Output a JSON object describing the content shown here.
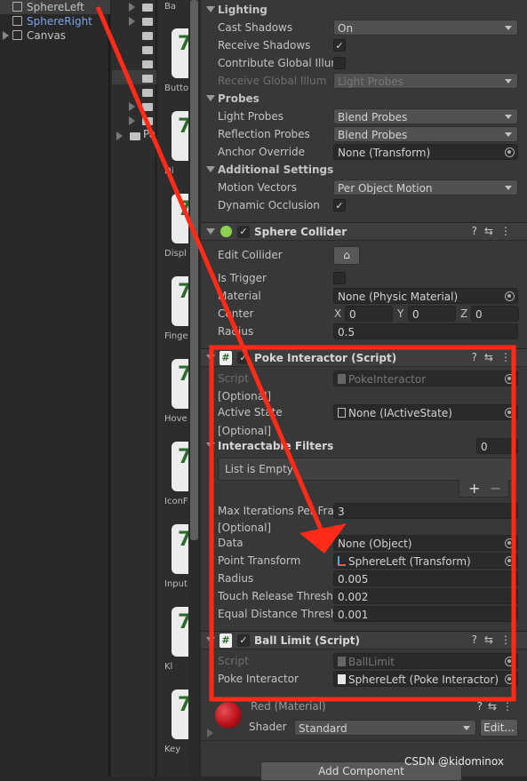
{
  "hierarchy": {
    "items": [
      {
        "label": "SphereLeft",
        "selected": true
      },
      {
        "label": "SphereRight",
        "color": "#7ba4e8"
      },
      {
        "label": "Canvas",
        "expandable": true
      }
    ]
  },
  "project": {
    "folder_short": "Pa"
  },
  "assets": {
    "items": [
      "Ba",
      "Butto",
      "Di",
      "Displ",
      "Finge",
      "Hove",
      "IconF",
      "Input",
      "Kl",
      "Key"
    ]
  },
  "inspector": {
    "sections": {
      "lighting": "Lighting",
      "probes": "Probes",
      "additional": "Additional Settings"
    },
    "rows": [
      {
        "k": "drop",
        "label": "Cast Shadows",
        "value": "On"
      },
      {
        "k": "chk",
        "label": "Receive Shadows",
        "checked": true
      },
      {
        "k": "chk",
        "label": "Contribute Global Illum",
        "checked": false
      },
      {
        "k": "drop",
        "label": "Receive Global Illum",
        "value": "Light Probes",
        "disabled": true
      },
      {
        "k": "drop",
        "label": "Light Probes",
        "value": "Blend Probes"
      },
      {
        "k": "drop",
        "label": "Reflection Probes",
        "value": "Blend Probes"
      },
      {
        "k": "obj",
        "label": "Anchor Override",
        "value": "None (Transform)"
      },
      {
        "k": "drop",
        "label": "Motion Vectors",
        "value": "Per Object Motion"
      },
      {
        "k": "chk",
        "label": "Dynamic Occlusion",
        "checked": true
      },
      {
        "k": "editbtn",
        "label": "Edit Collider"
      },
      {
        "k": "chk",
        "label": "Is Trigger",
        "checked": false
      },
      {
        "k": "obj",
        "label": "Material",
        "value": "None (Physic Material)"
      },
      {
        "k": "xyz",
        "label": "Center",
        "x": "0",
        "y": "0",
        "z": "0"
      },
      {
        "k": "text",
        "label": "Radius",
        "value": "0.5"
      },
      {
        "k": "obj",
        "label": "Script",
        "value": "PokeInteractor",
        "disabled": true
      },
      {
        "k": "note",
        "label": "[Optional]"
      },
      {
        "k": "obj",
        "label": "Active State",
        "value": "None (IActiveState)"
      },
      {
        "k": "note",
        "label": "[Optional]"
      },
      {
        "k": "list",
        "label": "Interactable Filters",
        "value": "0",
        "empty": "List is Empty"
      },
      {
        "k": "text",
        "label": "Max Iterations Per Frame",
        "value": "3"
      },
      {
        "k": "note",
        "label": "[Optional]"
      },
      {
        "k": "obj",
        "label": "Data",
        "value": "None (Object)"
      },
      {
        "k": "obj",
        "label": "Point Transform",
        "value": "SphereLeft (Transform)"
      },
      {
        "k": "text",
        "label": "Radius",
        "value": "0.005"
      },
      {
        "k": "text",
        "label": "Touch Release Threshold",
        "value": "0.002"
      },
      {
        "k": "text",
        "label": "Equal Distance Threshold",
        "value": "0.001"
      },
      {
        "k": "obj",
        "label": "Script",
        "value": "BallLimit",
        "disabled": true
      },
      {
        "k": "obj",
        "label": "Poke Interactor",
        "value": "SphereLeft (Poke Interactor)"
      }
    ],
    "components": [
      {
        "title": "Sphere Collider",
        "enabled": true
      },
      {
        "title": "Poke Interactor (Script)",
        "enabled": true
      },
      {
        "title": "Ball Limit (Script)",
        "enabled": true
      }
    ],
    "material": {
      "name": "Red (Material)",
      "shader_label": "Shader",
      "shader": "Standard",
      "edit": "Edit...",
      "color": "#c0141c"
    },
    "add_component": "Add Component"
  },
  "annotation": {
    "color": "#ff2a17"
  },
  "watermark": "CSDN @kidominox"
}
